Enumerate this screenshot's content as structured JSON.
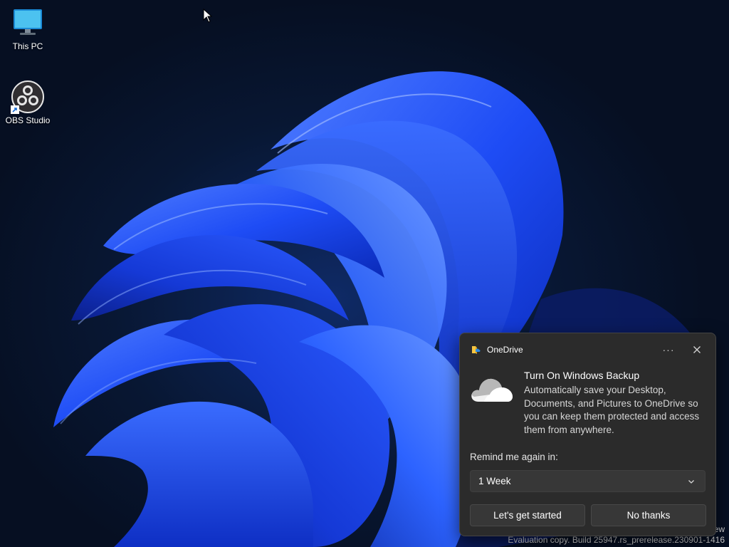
{
  "desktop": {
    "icons": [
      {
        "label": "This PC",
        "icon": "this-pc-icon"
      },
      {
        "label": "OBS Studio",
        "icon": "obs-studio-icon",
        "shortcut": true
      }
    ],
    "watermark": {
      "line1": "ew",
      "line2": "Evaluation copy. Build 25947.rs_prerelease.230901-1416"
    }
  },
  "toast": {
    "app_name": "OneDrive",
    "app_icon": "onedrive-app-icon",
    "more_label": "···",
    "title": "Turn On Windows Backup",
    "body": "Automatically save your Desktop, Documents, and Pictures to OneDrive so you can keep them protected and access them from anywhere.",
    "remind_label": "Remind me again in:",
    "remind_value": "1 Week",
    "primary_button": "Let's get started",
    "secondary_button": "No thanks"
  },
  "colors": {
    "toast_bg": "#2b2b2b",
    "button_bg": "#373737",
    "wallpaper_bloom": "#1f4dff",
    "desktop_bg": "#081733"
  }
}
